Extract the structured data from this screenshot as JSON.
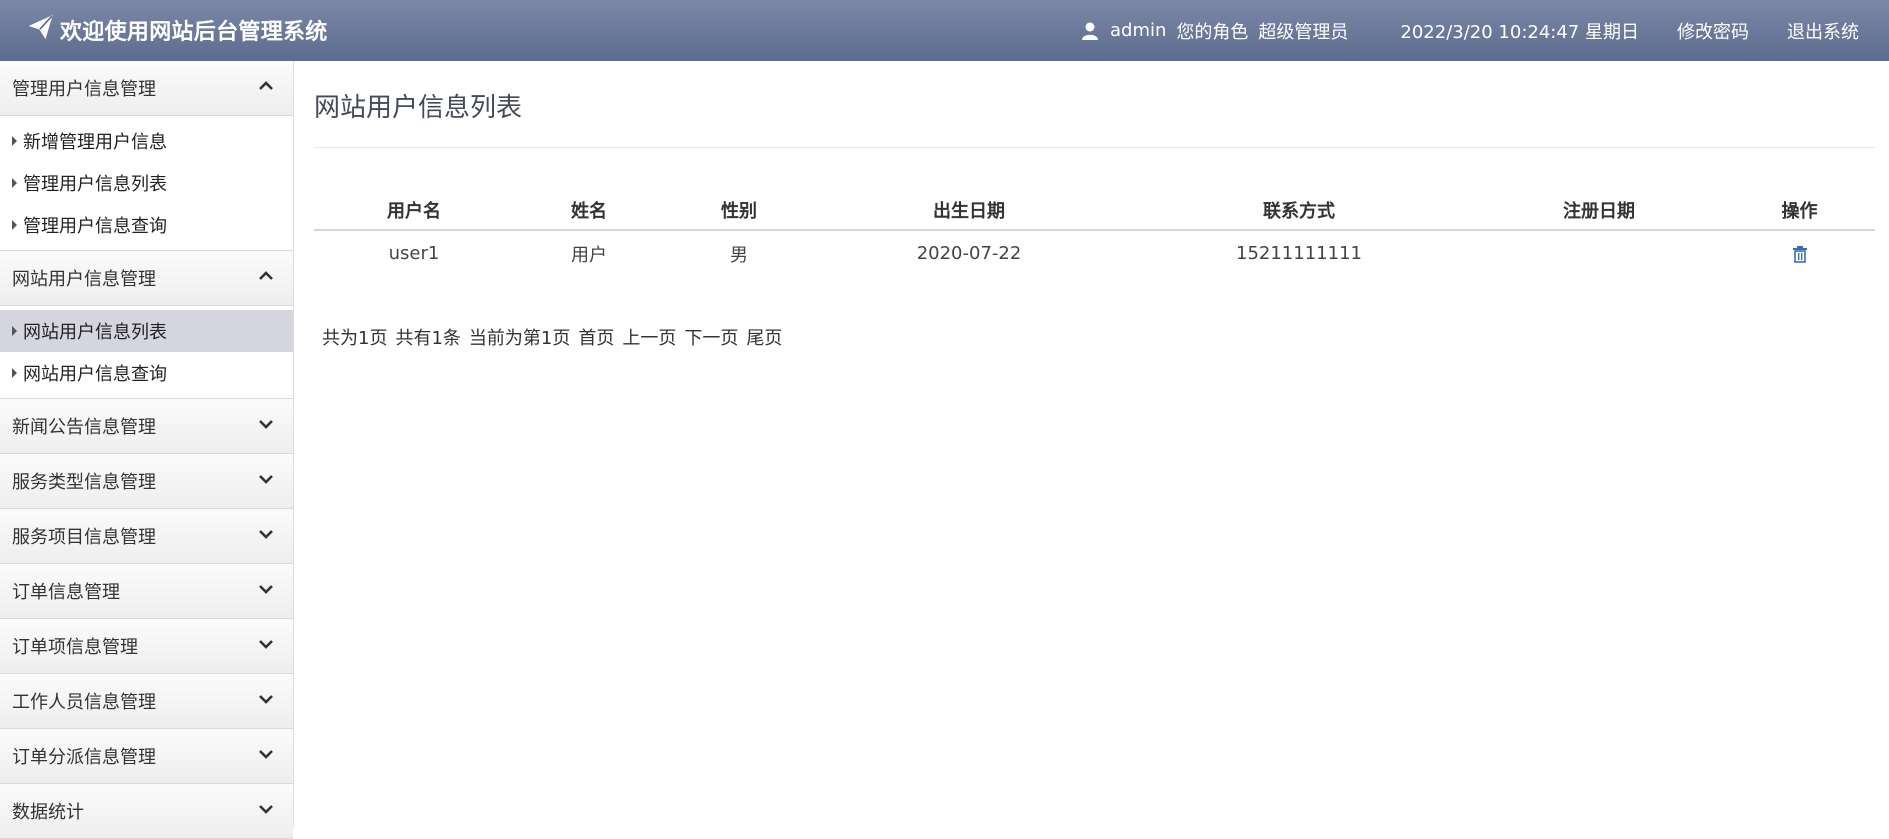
{
  "header": {
    "brand": "欢迎使用网站后台管理系统",
    "username": "admin",
    "role_label": "您的角色",
    "role": "超级管理员",
    "datetime": "2022/3/20 10:24:47 星期日",
    "change_password": "修改密码",
    "logout": "退出系统"
  },
  "sidebar": {
    "groups": [
      {
        "label": "管理用户信息管理",
        "expanded": true,
        "items": [
          "新增管理用户信息",
          "管理用户信息列表",
          "管理用户信息查询"
        ]
      },
      {
        "label": "网站用户信息管理",
        "expanded": true,
        "items": [
          "网站用户信息列表",
          "网站用户信息查询"
        ]
      },
      {
        "label": "新闻公告信息管理",
        "expanded": false
      },
      {
        "label": "服务类型信息管理",
        "expanded": false
      },
      {
        "label": "服务项目信息管理",
        "expanded": false
      },
      {
        "label": "订单信息管理",
        "expanded": false
      },
      {
        "label": "订单项信息管理",
        "expanded": false
      },
      {
        "label": "工作人员信息管理",
        "expanded": false
      },
      {
        "label": "订单分派信息管理",
        "expanded": false
      },
      {
        "label": "数据统计",
        "expanded": false
      }
    ],
    "active_item": "网站用户信息列表"
  },
  "main": {
    "title": "网站用户信息列表",
    "table": {
      "headers": [
        "用户名",
        "姓名",
        "性别",
        "出生日期",
        "联系方式",
        "注册日期",
        "操作"
      ],
      "rows": [
        [
          "user1",
          "用户",
          "男",
          "2020-07-22",
          "15211111111",
          ""
        ]
      ]
    },
    "pager": {
      "total_pages": "共为1页",
      "total_records": "共有1条",
      "current": "当前为第1页",
      "first": "首页",
      "prev": "上一页",
      "next": "下一页",
      "last": "尾页"
    }
  },
  "colors": {
    "header_top": "#7b88a8",
    "header_bottom": "#5d6b8d",
    "active_item_bg": "#d5d5df",
    "trash_icon": "#3b6fb4"
  }
}
